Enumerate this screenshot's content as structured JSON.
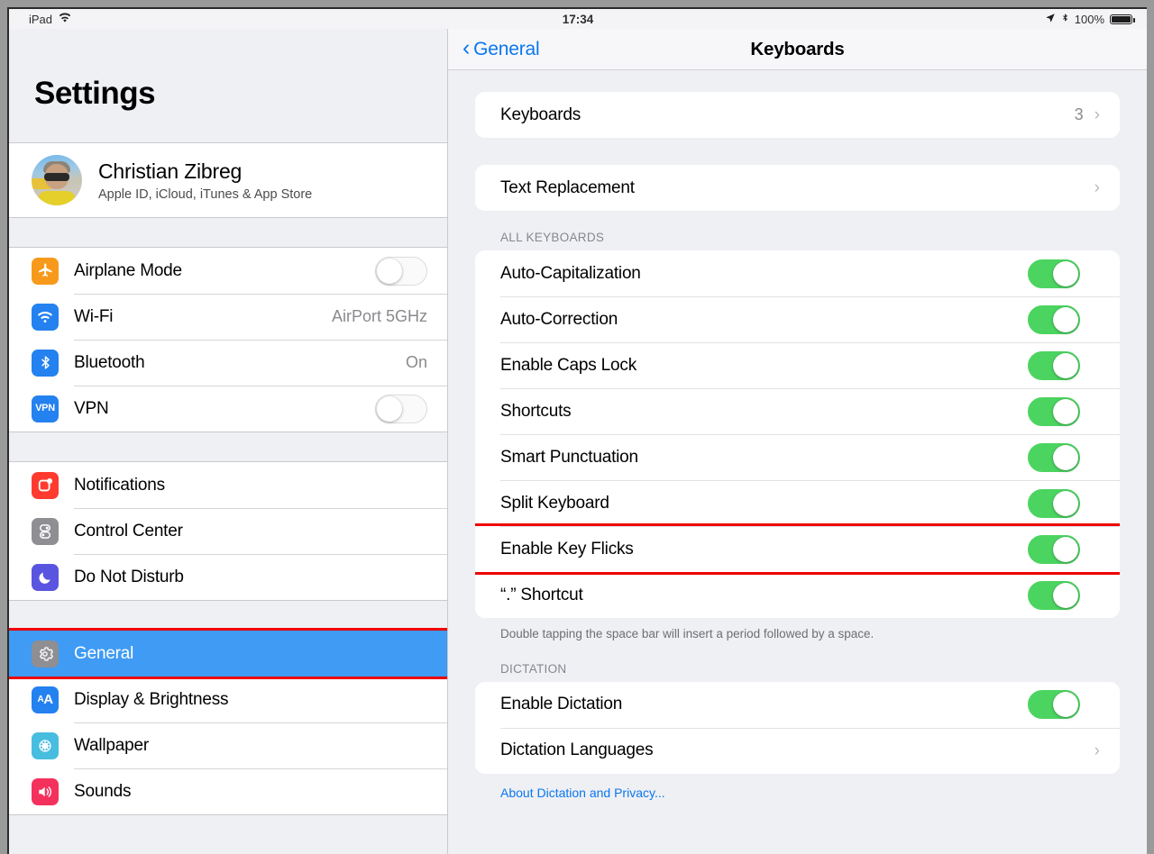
{
  "status_bar": {
    "device_label": "iPad",
    "wifi_icon": "wifi-icon",
    "time": "17:34",
    "location_icon": "location-arrow-icon",
    "bluetooth_icon": "bluetooth-icon",
    "battery_percent": "100%",
    "battery_icon": "battery-full-icon"
  },
  "sidebar": {
    "title": "Settings",
    "profile": {
      "name": "Christian Zibreg",
      "subtitle": "Apple ID, iCloud, iTunes & App Store",
      "avatar_icon": "user-avatar-photo"
    },
    "group1": [
      {
        "label": "Airplane Mode",
        "icon": "airplane-icon",
        "icon_color": "#f79a1b",
        "glyph": "✈",
        "control": "toggle",
        "toggle_on": false
      },
      {
        "label": "Wi-Fi",
        "icon": "wifi-icon",
        "icon_color": "#2481f0",
        "glyph": "◠",
        "control": "value",
        "value": "AirPort 5GHz"
      },
      {
        "label": "Bluetooth",
        "icon": "bluetooth-icon",
        "icon_color": "#2481f0",
        "glyph": "ᛦ",
        "control": "value",
        "value": "On"
      },
      {
        "label": "VPN",
        "icon": "vpn-icon",
        "icon_color": "#2481f0",
        "glyph": "VPN",
        "control": "toggle",
        "toggle_on": false
      }
    ],
    "group2": [
      {
        "label": "Notifications",
        "icon": "notifications-icon",
        "icon_color": "#ff3b30",
        "glyph": "▢"
      },
      {
        "label": "Control Center",
        "icon": "control-center-icon",
        "icon_color": "#8e8e93",
        "glyph": "⚙"
      },
      {
        "label": "Do Not Disturb",
        "icon": "do-not-disturb-icon",
        "icon_color": "#5a55e0",
        "glyph": "☾"
      }
    ],
    "group3": [
      {
        "label": "General",
        "icon": "gear-icon",
        "icon_color": "#8e8e93",
        "glyph": "⚙",
        "selected": true,
        "highlighted": true
      },
      {
        "label": "Display & Brightness",
        "icon": "display-brightness-icon",
        "icon_color": "#2481f0",
        "glyph": "AA"
      },
      {
        "label": "Wallpaper",
        "icon": "wallpaper-icon",
        "icon_color": "#47bde0",
        "glyph": "✻"
      },
      {
        "label": "Sounds",
        "icon": "sounds-icon",
        "icon_color": "#f4315c",
        "glyph": "🔊"
      }
    ]
  },
  "detail": {
    "back_label": "General",
    "title": "Keyboards",
    "top_group": [
      {
        "label": "Keyboards",
        "value": "3",
        "chevron": true
      },
      {
        "label": "Text Replacement",
        "value": "",
        "chevron": true
      }
    ],
    "all_keyboards_header": "ALL KEYBOARDS",
    "all_keyboards_rows": [
      {
        "label": "Auto-Capitalization",
        "toggle_on": true
      },
      {
        "label": "Auto-Correction",
        "toggle_on": true
      },
      {
        "label": "Enable Caps Lock",
        "toggle_on": true
      },
      {
        "label": "Shortcuts",
        "toggle_on": true
      },
      {
        "label": "Smart Punctuation",
        "toggle_on": true
      },
      {
        "label": "Split Keyboard",
        "toggle_on": true
      },
      {
        "label": "Enable Key Flicks",
        "toggle_on": true,
        "highlighted": true
      },
      {
        "label": "“.” Shortcut",
        "toggle_on": true
      }
    ],
    "footnote": "Double tapping the space bar will insert a period followed by a space.",
    "dictation_header": "DICTATION",
    "dictation_rows": [
      {
        "label": "Enable Dictation",
        "toggle_on": true
      },
      {
        "label": "Dictation Languages",
        "chevron": true
      }
    ],
    "dictation_link": "About Dictation and Privacy..."
  },
  "colors": {
    "accent_blue": "#0b76ef",
    "selection_blue": "#3f9bf4",
    "toggle_green": "#4cd461",
    "highlight_red": "#ee0000"
  }
}
